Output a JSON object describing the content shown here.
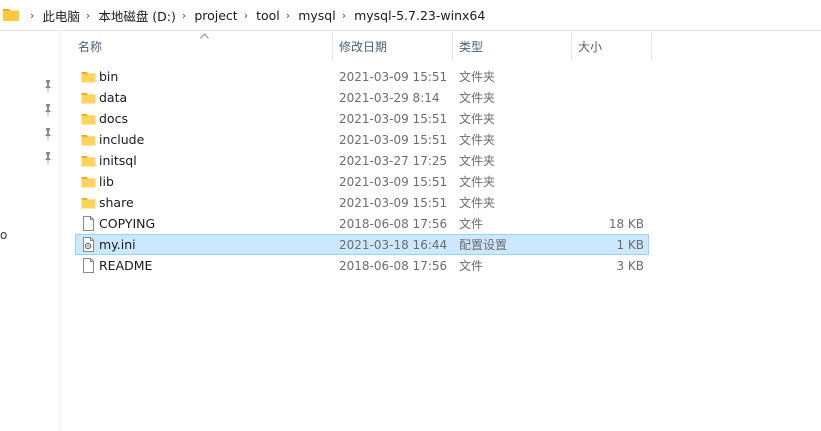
{
  "breadcrumb": [
    "此电脑",
    "本地磁盘 (D:)",
    "project",
    "tool",
    "mysql",
    "mysql-5.7.23-winx64"
  ],
  "nav": {
    "partial_label": "o"
  },
  "columns": {
    "name": "名称",
    "date": "修改日期",
    "type": "类型",
    "size": "大小"
  },
  "files": [
    {
      "name": "bin",
      "date": "2021-03-09 15:51",
      "type": "文件夹",
      "size": "",
      "icon": "folder-icon"
    },
    {
      "name": "data",
      "date": "2021-03-29 8:14",
      "type": "文件夹",
      "size": "",
      "icon": "folder-icon"
    },
    {
      "name": "docs",
      "date": "2021-03-09 15:51",
      "type": "文件夹",
      "size": "",
      "icon": "folder-icon"
    },
    {
      "name": "include",
      "date": "2021-03-09 15:51",
      "type": "文件夹",
      "size": "",
      "icon": "folder-icon"
    },
    {
      "name": "initsql",
      "date": "2021-03-27 17:25",
      "type": "文件夹",
      "size": "",
      "icon": "folder-icon"
    },
    {
      "name": "lib",
      "date": "2021-03-09 15:51",
      "type": "文件夹",
      "size": "",
      "icon": "folder-icon"
    },
    {
      "name": "share",
      "date": "2021-03-09 15:51",
      "type": "文件夹",
      "size": "",
      "icon": "folder-icon"
    },
    {
      "name": "COPYING",
      "date": "2018-06-08 17:56",
      "type": "文件",
      "size": "18 KB",
      "icon": "file-icon"
    },
    {
      "name": "my.ini",
      "date": "2021-03-18 16:44",
      "type": "配置设置",
      "size": "1 KB",
      "icon": "config-file-icon",
      "selected": true
    },
    {
      "name": "README",
      "date": "2018-06-08 17:56",
      "type": "文件",
      "size": "3 KB",
      "icon": "file-icon"
    }
  ],
  "colors": {
    "folder": "#ffc83d",
    "folder_dark": "#e6a817",
    "selection_bg": "#cce8ff",
    "selection_border": "#99d1ff",
    "header_text": "#4c607a"
  }
}
